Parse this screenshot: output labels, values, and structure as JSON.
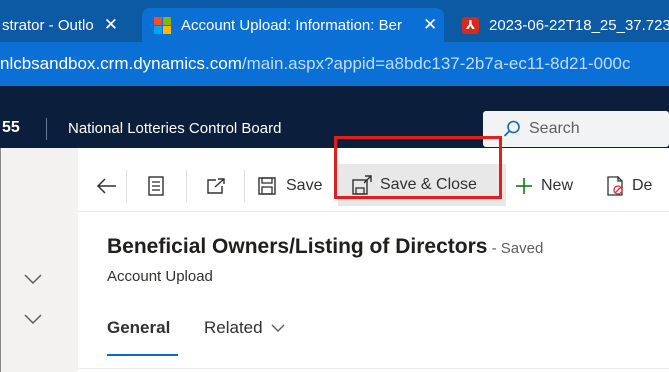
{
  "browser": {
    "tabs": [
      {
        "title": "strator - Outlo",
        "close": "✕"
      },
      {
        "title": "Account Upload: Information: Ber",
        "close": "✕"
      },
      {
        "title": "2023-06-22T18_25_37.723"
      }
    ],
    "url_host": "nlcbsandbox.crm.dynamics.com",
    "url_path": "/main.aspx?appid=a8bdc137-2b7a-ec11-8d21-000c"
  },
  "navbar": {
    "app_suffix": "55",
    "org_name": "National Lotteries Control Board",
    "search_placeholder": "Search"
  },
  "commandbar": {
    "save": "Save",
    "save_close": "Save & Close",
    "new": "New",
    "delete": "De"
  },
  "form": {
    "title": "Beneficial Owners/Listing of Directors",
    "status": " - Saved",
    "entity": "Account Upload",
    "tabs": [
      "General",
      "Related"
    ]
  },
  "colors": {
    "tabstrip": "#0c59a4",
    "address_bar": "#0a70d6",
    "navbar": "#0b1e3b",
    "highlight": "#e0201c",
    "accent": "#0f6cbd"
  }
}
